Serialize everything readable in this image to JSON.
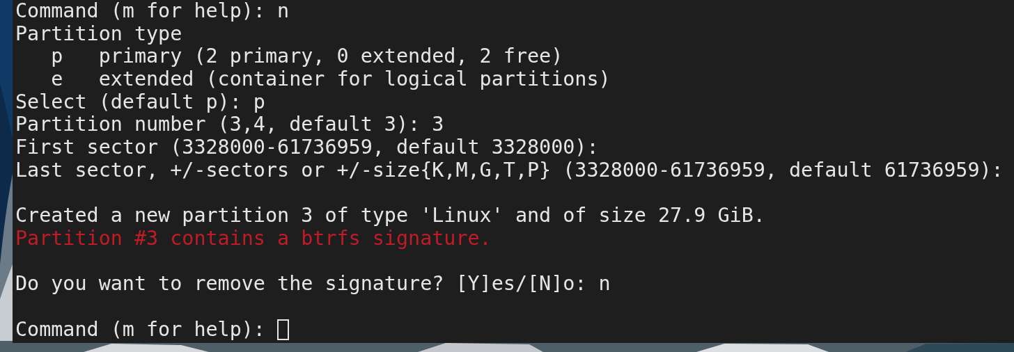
{
  "terminal": {
    "lines": [
      {
        "kind": "normal",
        "text": "Command (m for help): n"
      },
      {
        "kind": "normal",
        "text": "Partition type"
      },
      {
        "kind": "normal",
        "text": "   p   primary (2 primary, 0 extended, 2 free)"
      },
      {
        "kind": "normal",
        "text": "   e   extended (container for logical partitions)"
      },
      {
        "kind": "normal",
        "text": "Select (default p): p"
      },
      {
        "kind": "normal",
        "text": "Partition number (3,4, default 3): 3"
      },
      {
        "kind": "normal",
        "text": "First sector (3328000-61736959, default 3328000):"
      },
      {
        "kind": "normal",
        "text": "Last sector, +/-sectors or +/-size{K,M,G,T,P} (3328000-61736959, default 61736959):"
      },
      {
        "kind": "blank"
      },
      {
        "kind": "normal",
        "text": "Created a new partition 3 of type 'Linux' and of size 27.9 GiB."
      },
      {
        "kind": "error",
        "text": "Partition #3 contains a btrfs signature."
      },
      {
        "kind": "blank"
      },
      {
        "kind": "normal",
        "text": "Do you want to remove the signature? [Y]es/[N]o: n"
      },
      {
        "kind": "blank"
      },
      {
        "kind": "normal",
        "text": "Command (m for help): ",
        "cursor": true
      }
    ]
  }
}
